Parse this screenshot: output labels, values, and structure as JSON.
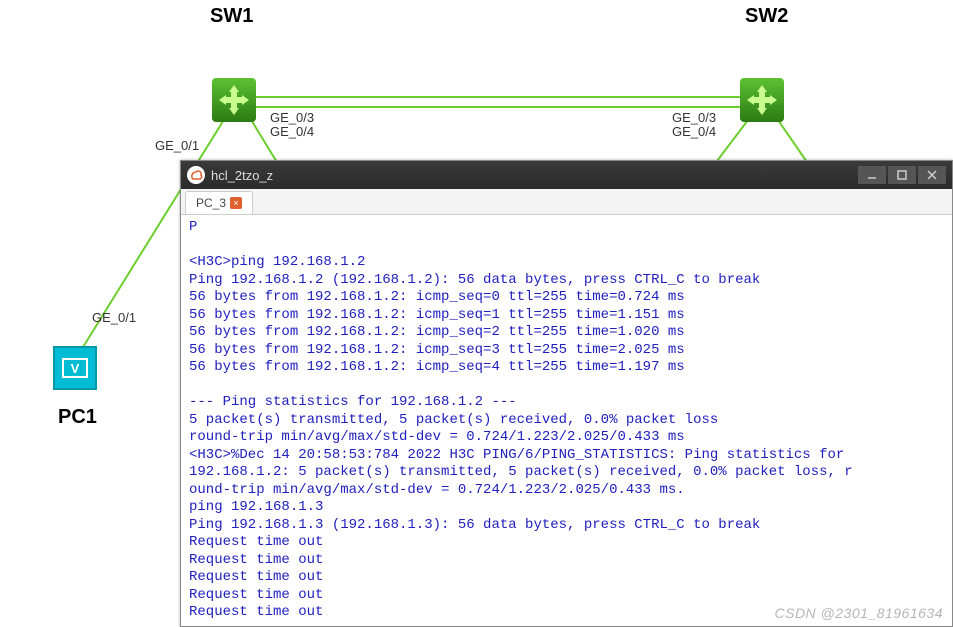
{
  "labels": {
    "sw1": "SW1",
    "sw2": "SW2",
    "pc1": "PC1"
  },
  "ports": {
    "sw1_ge01": "GE_0/1",
    "sw1_ge03": "GE_0/3",
    "sw1_ge04": "GE_0/4",
    "sw2_ge03": "GE_0/3",
    "sw2_ge04": "GE_0/4",
    "pc1_ge01": "GE_0/1"
  },
  "window": {
    "title": "hcl_2tzo_z",
    "tab": "PC_3"
  },
  "terminal_lines": [
    "P",
    "",
    "<H3C>ping 192.168.1.2",
    "Ping 192.168.1.2 (192.168.1.2): 56 data bytes, press CTRL_C to break",
    "56 bytes from 192.168.1.2: icmp_seq=0 ttl=255 time=0.724 ms",
    "56 bytes from 192.168.1.2: icmp_seq=1 ttl=255 time=1.151 ms",
    "56 bytes from 192.168.1.2: icmp_seq=2 ttl=255 time=1.020 ms",
    "56 bytes from 192.168.1.2: icmp_seq=3 ttl=255 time=2.025 ms",
    "56 bytes from 192.168.1.2: icmp_seq=4 ttl=255 time=1.197 ms",
    "",
    "--- Ping statistics for 192.168.1.2 ---",
    "5 packet(s) transmitted, 5 packet(s) received, 0.0% packet loss",
    "round-trip min/avg/max/std-dev = 0.724/1.223/2.025/0.433 ms",
    "<H3C>%Dec 14 20:58:53:784 2022 H3C PING/6/PING_STATISTICS: Ping statistics for",
    "192.168.1.2: 5 packet(s) transmitted, 5 packet(s) received, 0.0% packet loss, r",
    "ound-trip min/avg/max/std-dev = 0.724/1.223/2.025/0.433 ms.",
    "ping 192.168.1.3",
    "Ping 192.168.1.3 (192.168.1.3): 56 data bytes, press CTRL_C to break",
    "Request time out",
    "Request time out",
    "Request time out",
    "Request time out",
    "Request time out"
  ],
  "watermark": "CSDN @2301_81961634"
}
